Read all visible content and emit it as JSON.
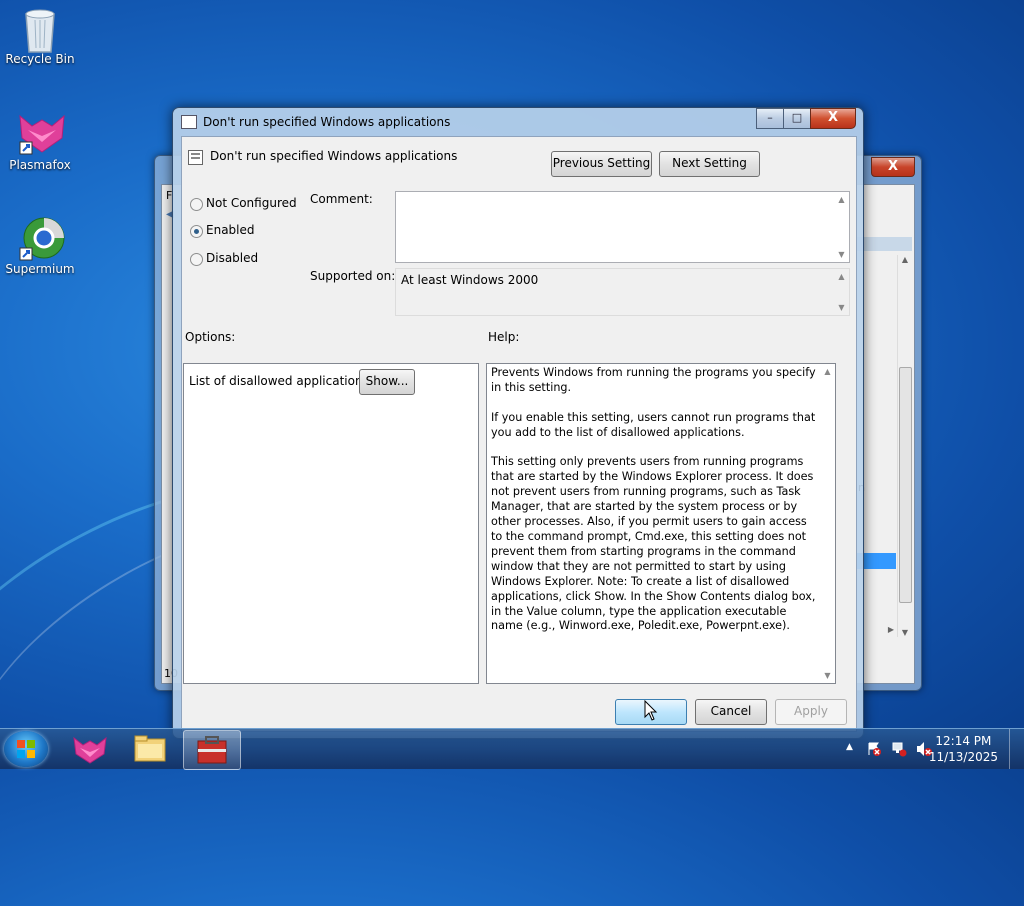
{
  "desktop": {
    "icons": [
      {
        "label": "Recycle Bin",
        "icon": "recycle-bin-icon"
      },
      {
        "label": "Plasmafox",
        "icon": "plasmafox-icon"
      },
      {
        "label": "Supermium",
        "icon": "supermium-icon"
      }
    ]
  },
  "back_window": {
    "close_glyph": "X",
    "fragments": [
      "F",
      "n",
      "10"
    ]
  },
  "dialog": {
    "title": "Don't run specified Windows applications",
    "header_title": "Don't run specified Windows applications",
    "previous_setting_label": "Previous Setting",
    "next_setting_label": "Next Setting",
    "radio_options": [
      {
        "label": "Not Configured",
        "selected": false
      },
      {
        "label": "Enabled",
        "selected": true
      },
      {
        "label": "Disabled",
        "selected": false
      }
    ],
    "comment_label": "Comment:",
    "comment_value": "",
    "supported_on_label": "Supported on:",
    "supported_on_value": "At least Windows 2000",
    "options_label": "Options:",
    "help_label": "Help:",
    "option_item_label": "List of disallowed applications",
    "show_button_label": "Show...",
    "help_text": "Prevents Windows from running the programs you specify in this setting.\n\nIf you enable this setting, users cannot run programs that you add to the list of disallowed applications.\n\nThis setting only prevents users from running programs that are started by the Windows Explorer process. It does not prevent users from running programs, such as Task Manager, that are started by the system process or by other processes. Also, if you permit users to gain access to the command prompt, Cmd.exe, this setting does not prevent them from starting programs in the command window that they are not permitted to start by using Windows Explorer. Note: To create a list of disallowed applications, click Show. In the Show Contents dialog box, in the Value column, type the application executable name (e.g., Winword.exe, Poledit.exe, Powerpnt.exe).",
    "ok_label": "",
    "cancel_label": "Cancel",
    "apply_label": "Apply",
    "caption_buttons": {
      "minimize": "–",
      "maximize": "□",
      "close": "X"
    }
  },
  "taskbar": {
    "items": [
      {
        "name": "plasmafox-taskbar-icon",
        "active": false
      },
      {
        "name": "explorer-taskbar-icon",
        "active": false
      },
      {
        "name": "group-policy-taskbar-icon",
        "active": true
      }
    ],
    "tray_arrow": "▲",
    "time": "12:14 PM",
    "date": "11/13/2025"
  },
  "colors": {
    "desktop_blue": "#1a6cc8",
    "window_frame": "#b9d1ea",
    "selection_blue": "#3399ff"
  }
}
